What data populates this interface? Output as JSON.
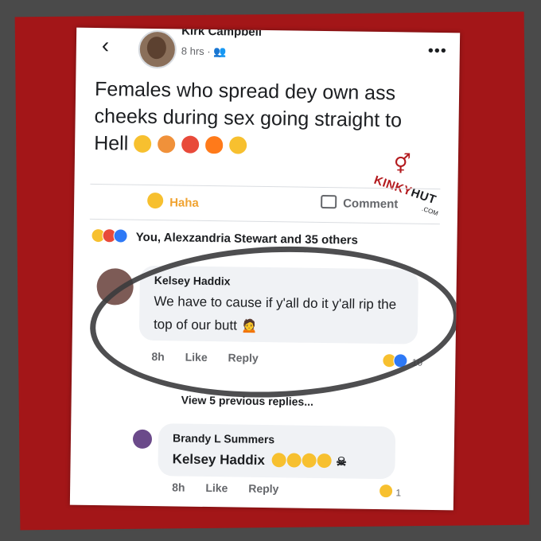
{
  "post": {
    "author": "Kirk Campbell",
    "time": "8 hrs · ",
    "audience_icon": "friends-icon",
    "text": "Females who spread dey own ass cheeks during sex going straight to Hell"
  },
  "actions": {
    "haha_label": "Haha",
    "comment_label": "Comment"
  },
  "reactions_text": "You, Alexzandria Stewart and 35 others",
  "watermark": {
    "part1": "KINKY",
    "part2": "HUT",
    "com": ".COM"
  },
  "comments": [
    {
      "name": "Kelsey Haddix",
      "text": "We have to cause if y'all do it y'all rip the top of our butt",
      "time": "8h",
      "like": "Like",
      "reply": "Reply",
      "reaction_count": "10"
    },
    {
      "name": "Brandy L Summers",
      "text": "Kelsey Haddix",
      "time": "8h",
      "like": "Like",
      "reply": "Reply",
      "reaction_count": "1"
    }
  ],
  "view_previous": "View 5 previous replies...",
  "colors": {
    "frame": "#a31618",
    "haha": "#f0a331",
    "circle": "#3b3b3d"
  }
}
